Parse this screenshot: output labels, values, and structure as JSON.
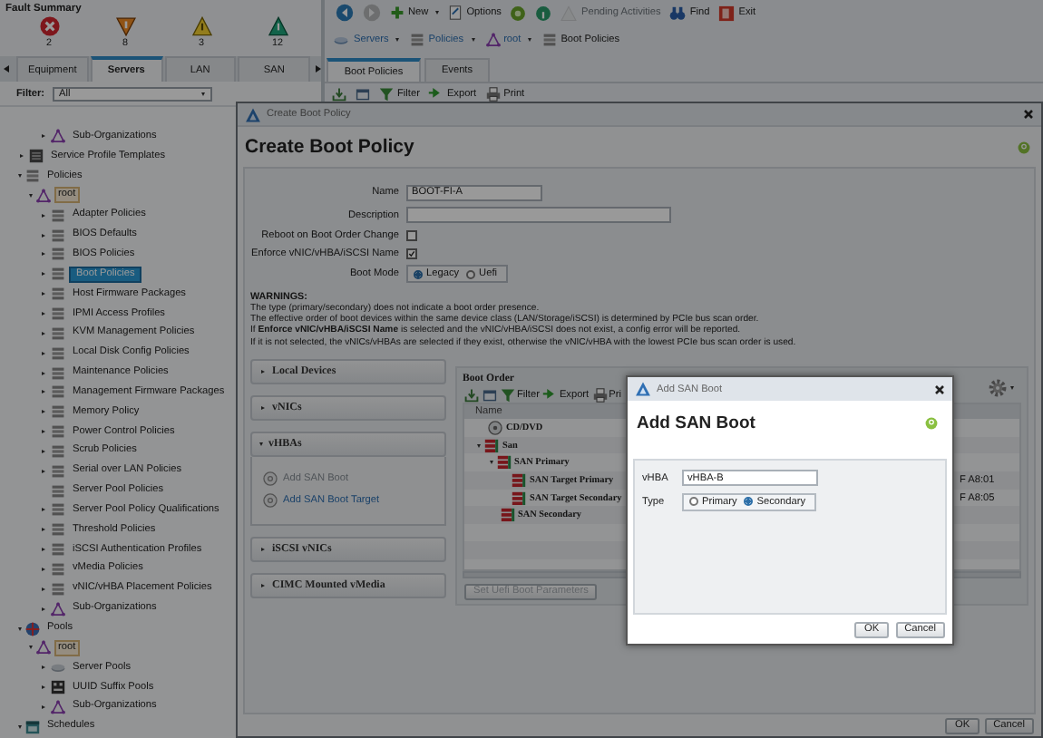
{
  "fault_summary": {
    "title": "Fault Summary",
    "faults": [
      {
        "kind": "critical",
        "count": "2"
      },
      {
        "kind": "major",
        "count": "8"
      },
      {
        "kind": "minor",
        "count": "3"
      },
      {
        "kind": "warning",
        "count": "12"
      }
    ]
  },
  "nav_tabs": [
    {
      "label": "Equipment",
      "selected": false
    },
    {
      "label": "Servers",
      "selected": true
    },
    {
      "label": "LAN",
      "selected": false
    },
    {
      "label": "SAN",
      "selected": false
    }
  ],
  "filter": {
    "label": "Filter:",
    "value": "All"
  },
  "tree": [
    {
      "children": [
        {
          "children": [
            {
              "label": "Sub-Organizations",
              "kind": "org",
              "expanded": false,
              "selected": false
            }
          ]
        }
      ]
    },
    {
      "label": "Service Profile Templates",
      "kind": "templates",
      "expanded": false,
      "selected": false
    },
    {
      "label": "Policies",
      "kind": "policy",
      "expanded": true,
      "selected": false,
      "children": [
        {
          "label": "root",
          "kind": "org",
          "expanded": true,
          "selected": false,
          "children": [
            {
              "label": "Adapter Policies",
              "kind": "policy",
              "expanded": false,
              "selected": false
            },
            {
              "label": "BIOS Defaults",
              "kind": "policy",
              "expanded": false,
              "selected": false
            },
            {
              "label": "BIOS Policies",
              "kind": "policy",
              "expanded": false,
              "selected": false
            },
            {
              "label": "Boot Policies",
              "kind": "policy",
              "expanded": false,
              "selected": true
            },
            {
              "label": "Host Firmware Packages",
              "kind": "policy",
              "expanded": false,
              "selected": false
            },
            {
              "label": "IPMI Access Profiles",
              "kind": "policy",
              "expanded": false,
              "selected": false
            },
            {
              "label": "KVM Management Policies",
              "kind": "policy",
              "expanded": false,
              "selected": false
            },
            {
              "label": "Local Disk Config Policies",
              "kind": "policy",
              "expanded": false,
              "selected": false
            },
            {
              "label": "Maintenance Policies",
              "kind": "policy",
              "expanded": false,
              "selected": false
            },
            {
              "label": "Management Firmware Packages",
              "kind": "policy",
              "expanded": false,
              "selected": false
            },
            {
              "label": "Memory Policy",
              "kind": "policy",
              "expanded": false,
              "selected": false
            },
            {
              "label": "Power Control Policies",
              "kind": "policy",
              "expanded": false,
              "selected": false
            },
            {
              "label": "Scrub Policies",
              "kind": "policy",
              "expanded": false,
              "selected": false
            },
            {
              "label": "Serial over LAN Policies",
              "kind": "policy",
              "expanded": false,
              "selected": false
            },
            {
              "label": "Server Pool Policies",
              "kind": "policy",
              "selected": false
            },
            {
              "label": "Server Pool Policy Qualifications",
              "kind": "policy",
              "expanded": false,
              "selected": false
            },
            {
              "label": "Threshold Policies",
              "kind": "policy",
              "expanded": false,
              "selected": false
            },
            {
              "label": "iSCSI Authentication Profiles",
              "kind": "policy",
              "expanded": false,
              "selected": false
            },
            {
              "label": "vMedia Policies",
              "kind": "policy",
              "expanded": false,
              "selected": false
            },
            {
              "label": "vNIC/vHBA Placement Policies",
              "kind": "policy",
              "expanded": false,
              "selected": false
            },
            {
              "label": "Sub-Organizations",
              "kind": "org",
              "expanded": false,
              "selected": false
            }
          ]
        }
      ]
    },
    {
      "label": "Pools",
      "kind": "pools",
      "expanded": true,
      "selected": false,
      "children": [
        {
          "label": "root",
          "kind": "org",
          "expanded": true,
          "selected": false,
          "children": [
            {
              "label": "Server Pools",
              "kind": "server-pools",
              "expanded": false,
              "selected": false
            },
            {
              "label": "UUID Suffix Pools",
              "kind": "uuid",
              "expanded": false,
              "selected": false
            },
            {
              "label": "Sub-Organizations",
              "kind": "org",
              "expanded": false,
              "selected": false
            }
          ]
        }
      ]
    },
    {
      "label": "Schedules",
      "kind": "schedules",
      "expanded": true,
      "selected": false
    }
  ],
  "toolbar": [
    {
      "kind": "nav-back",
      "disabled": false
    },
    {
      "kind": "nav-forward",
      "disabled": true
    },
    {
      "kind": "new",
      "label": "New",
      "dropdown": true,
      "disabled": false
    },
    {
      "kind": "options",
      "label": "Options",
      "disabled": false
    },
    {
      "kind": "status",
      "disabled": false
    },
    {
      "kind": "info",
      "disabled": false
    },
    {
      "kind": "pending",
      "label": "Pending Activities",
      "disabled": true
    },
    {
      "kind": "find",
      "label": "Find",
      "disabled": false
    },
    {
      "kind": "exit",
      "label": "Exit",
      "disabled": false
    }
  ],
  "breadcrumb": [
    {
      "kind": "servers",
      "label": "Servers",
      "dropdown": true
    },
    {
      "kind": "policy",
      "label": "Policies",
      "dropdown": true
    },
    {
      "kind": "org",
      "label": "root",
      "dropdown": true
    },
    {
      "kind": "policy",
      "label": "Boot Policies",
      "dropdown": false
    }
  ],
  "content_tabs": [
    {
      "label": "Boot Policies",
      "selected": true
    },
    {
      "label": "Events",
      "selected": false
    }
  ],
  "content_toolbar": [
    {
      "kind": "tray"
    },
    {
      "kind": "window"
    },
    {
      "kind": "filter",
      "label": "Filter"
    },
    {
      "kind": "export",
      "label": "Export"
    },
    {
      "kind": "print",
      "label": "Print"
    }
  ],
  "create_dialog": {
    "title": "Create Boot Policy",
    "heading": "Create Boot Policy",
    "name": {
      "label": "Name",
      "value": "BOOT-FI-A"
    },
    "description": {
      "label": "Description"
    },
    "reboot_on_change": {
      "label": "Reboot on Boot Order Change",
      "checked": false
    },
    "enforce_name": {
      "label": "Enforce vNIC/vHBA/iSCSI Name",
      "checked": true
    },
    "boot_mode": {
      "label": "Boot Mode",
      "options": [
        {
          "label": "Legacy",
          "selected": true
        },
        {
          "label": "Uefi",
          "selected": false
        }
      ]
    },
    "warnings": {
      "title": "WARNINGS:",
      "lines": [
        "The type (primary/secondary) does not indicate a boot order presence.",
        "The effective order of boot devices within the same device class (LAN/Storage/iSCSI) is determined by PCIe bus scan order.",
        "If **Enforce vNIC/vHBA/iSCSI Name** is selected and the vNIC/vHBA/iSCSI does not exist, a config error will be reported.",
        "If it is not selected, the vNICs/vHBAs are selected if they exist, otherwise the vNIC/vHBA with the lowest PCIe bus scan order is used."
      ]
    },
    "sections": [
      {
        "label": "Local Devices",
        "expanded": false
      },
      {
        "label": "vNICs",
        "expanded": false
      },
      {
        "label": "vHBAs",
        "expanded": true,
        "actions": [
          {
            "label": "Add SAN Boot",
            "disabled": true
          },
          {
            "label": "Add SAN Boot Target",
            "disabled": false
          }
        ]
      },
      {
        "label": "iSCSI vNICs",
        "expanded": false
      },
      {
        "label": "CIMC Mounted vMedia",
        "expanded": false
      }
    ],
    "boot_order": {
      "title": "Boot Order",
      "toolbar": [
        {
          "kind": "tray"
        },
        {
          "kind": "window"
        },
        {
          "kind": "filter",
          "label": "Filter"
        },
        {
          "kind": "export",
          "label": "Export"
        },
        {
          "kind": "print",
          "label": "Pri"
        }
      ],
      "columns": [
        "Name"
      ],
      "rows": [
        {
          "name": "CD/DVD",
          "kind": "cd"
        },
        {
          "name": "San",
          "kind": "san",
          "expanded": true,
          "children": [
            {
              "name": "SAN Primary",
              "kind": "san",
              "expanded": true,
              "children": [
                {
                  "name": "SAN Target Primary",
                  "kind": "san",
                  "column_2": "F A8:01"
                },
                {
                  "name": "SAN Target Secondary",
                  "kind": "san",
                  "column_2": "F A8:05"
                }
              ]
            },
            {
              "name": "SAN Secondary",
              "kind": "san"
            }
          ]
        }
      ],
      "uefi_button": {
        "label": "Set Uefi Boot Parameters",
        "disabled": true
      }
    },
    "buttons": [
      "OK",
      "Cancel"
    ]
  },
  "san_dialog": {
    "title": "Add SAN Boot",
    "heading": "Add SAN Boot",
    "vhba": {
      "label": "vHBA",
      "value": "vHBA-B"
    },
    "type": {
      "label": "Type",
      "options": [
        {
          "label": "Primary",
          "selected": false
        },
        {
          "label": "Secondary",
          "selected": true
        }
      ]
    },
    "buttons": [
      "OK",
      "Cancel"
    ]
  }
}
